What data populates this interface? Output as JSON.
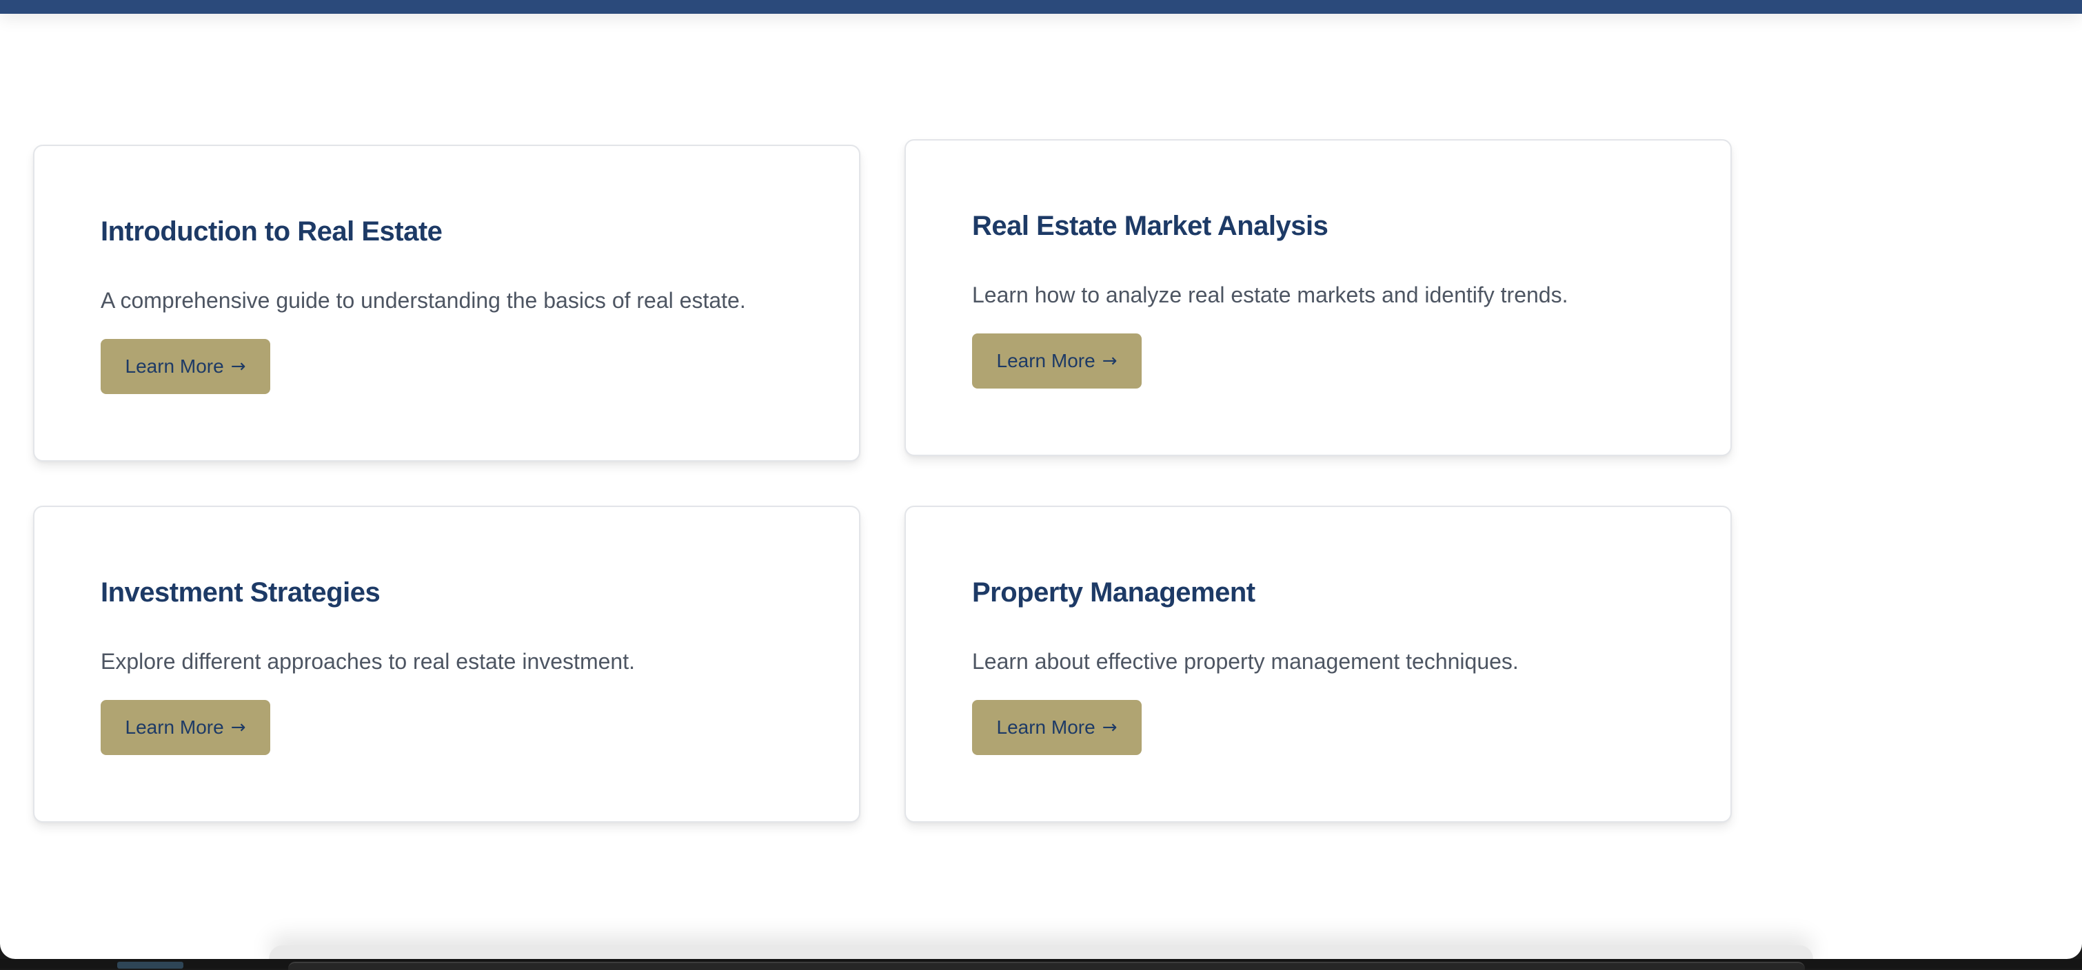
{
  "colors": {
    "header_bar": "#2b4a7b",
    "title": "#1d3a66",
    "description": "#4d5562",
    "button_bg": "#b0a472",
    "button_text": "#1d3a66",
    "card_border": "#e3e5e9"
  },
  "cards": [
    {
      "title": "Introduction to Real Estate",
      "description": "A comprehensive guide to understanding the basics of real estate.",
      "button_label": "Learn More",
      "button_icon": "arrow-right-icon"
    },
    {
      "title": "Real Estate Market Analysis",
      "description": "Learn how to analyze real estate markets and identify trends.",
      "button_label": "Learn More",
      "button_icon": "arrow-right-icon"
    },
    {
      "title": "Investment Strategies",
      "description": "Explore different approaches to real estate investment.",
      "button_label": "Learn More",
      "button_icon": "arrow-right-icon"
    },
    {
      "title": "Property Management",
      "description": "Learn about effective property management techniques.",
      "button_label": "Learn More",
      "button_icon": "arrow-right-icon"
    }
  ]
}
